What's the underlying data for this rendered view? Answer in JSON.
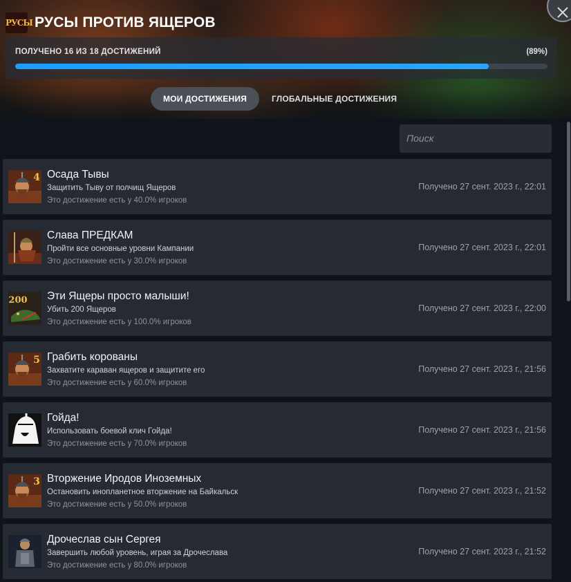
{
  "header": {
    "logo_text": "РУСЫ",
    "title": "РУСЫ ПРОТИВ ЯЩЕРОВ",
    "close_icon": "close-icon"
  },
  "progress": {
    "label": "ПОЛУЧЕНО 16 ИЗ 18 ДОСТИЖЕНИЙ",
    "percent_text": "(89%)",
    "fraction": 0.89,
    "fill_color": "#1a9fff"
  },
  "tabs": {
    "mine": "МОИ ДОСТИЖЕНИЯ",
    "global": "ГЛОБАЛЬНЫЕ ДОСТИЖЕНИЯ"
  },
  "search": {
    "placeholder": "Поиск"
  },
  "achievements": [
    {
      "title": "Осада Тывы",
      "desc": "Защитить Тыву от полчищ Ящеров",
      "rarity": "Это достижение есть у 40.0% игроков",
      "date": "Получено 27 сент. 2023 г., 22:01",
      "badge": "4",
      "icon": "warrior-badge-icon"
    },
    {
      "title": "Слава ПРЕДКАМ",
      "desc": "Пройти все основные уровни Кампании",
      "rarity": "Это достижение есть у 30.0% игроков",
      "date": "Получено 27 сент. 2023 г., 22:01",
      "badge": "",
      "icon": "warrior-spear-icon"
    },
    {
      "title": "Эти Ящеры просто малыши!",
      "desc": "Убить 200 Ящеров",
      "rarity": "Это достижение есть у 100.0% игроков",
      "date": "Получено 27 сент. 2023 г., 22:00",
      "badge": "200",
      "icon": "lizard-icon"
    },
    {
      "title": "Грабить корованы",
      "desc": "Захватите караван ящеров и защитите его",
      "rarity": "Это достижение есть у 60.0% игроков",
      "date": "Получено 27 сент. 2023 г., 21:56",
      "badge": "5",
      "icon": "warrior-badge-icon"
    },
    {
      "title": "Гойда!",
      "desc": "Использовать боевой клич Гойда!",
      "rarity": "Это достижение есть у 70.0% игроков",
      "date": "Получено 27 сент. 2023 г., 21:56",
      "badge": "",
      "icon": "shouting-warrior-icon"
    },
    {
      "title": "Вторжение Иродов Иноземных",
      "desc": "Остановить инопланетное вторжение на Байкальск",
      "rarity": "Это достижение есть у 50.0% игроков",
      "date": "Получено 27 сент. 2023 г., 21:52",
      "badge": "3",
      "icon": "warrior-badge-icon"
    },
    {
      "title": "Дрочеслав сын Сергея",
      "desc": "Завершить любой уровень, играя за Дрочеслава",
      "rarity": "Это достижение есть у 80.0% игроков",
      "date": "Получено 27 сент. 2023 г., 21:52",
      "badge": "",
      "icon": "armored-warrior-icon"
    }
  ]
}
